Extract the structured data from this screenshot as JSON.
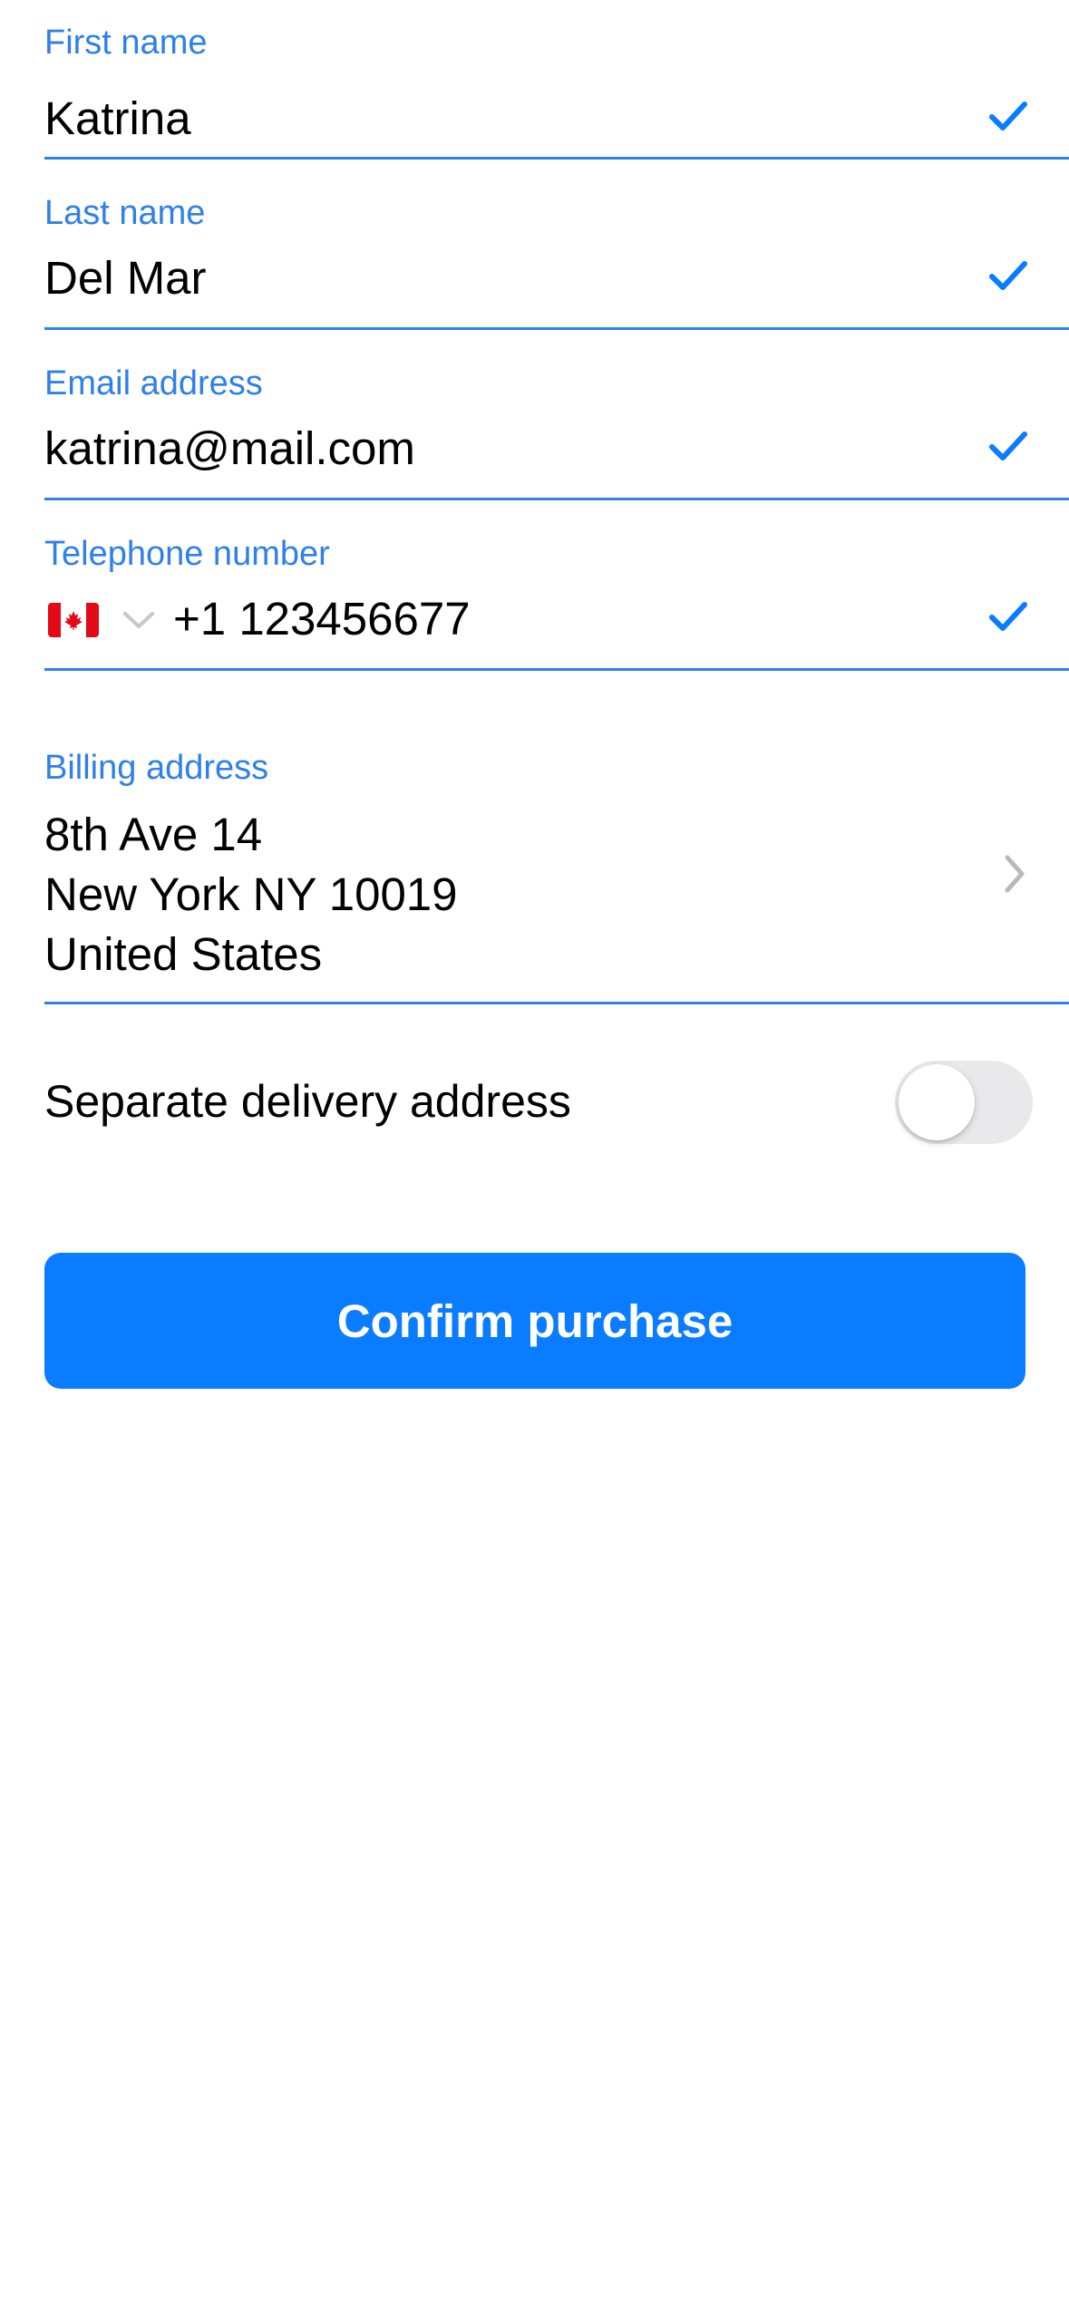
{
  "colors": {
    "accent": "#2f80e8",
    "button": "#0a7cff",
    "toggle_off": "#e9e9eb"
  },
  "form": {
    "first_name": {
      "label": "First name",
      "value": "Katrina",
      "valid": true
    },
    "last_name": {
      "label": "Last name",
      "value": "Del Mar",
      "valid": true
    },
    "email": {
      "label": "Email address",
      "value": "katrina@mail.com",
      "valid": true
    },
    "phone": {
      "label": "Telephone number",
      "country_flag": "canada-flag-icon",
      "value": "+1 123456677",
      "valid": true
    },
    "billing": {
      "label": "Billing address",
      "lines": [
        "8th Ave 14",
        "New York NY 10019",
        "United States"
      ]
    },
    "delivery": {
      "label": "Separate delivery address",
      "enabled": false
    },
    "confirm_label": "Confirm purchase"
  }
}
